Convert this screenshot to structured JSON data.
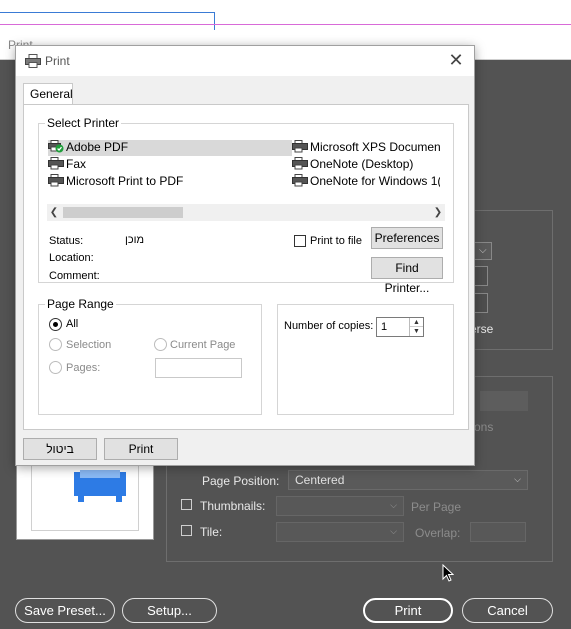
{
  "background": {
    "window_title": "Print",
    "reverse_pages_fragment": "erse",
    "pages_options_fragment": "tions",
    "page_position_label": "Page Position:",
    "page_position_value": "Centered",
    "thumbnails_label": "Thumbnails:",
    "per_page_label": "Per Page",
    "tile_label": "Tile:",
    "overlap_label": "Overlap:",
    "buttons": {
      "save_preset": "Save Preset...",
      "setup": "Setup...",
      "print": "Print",
      "cancel": "Cancel"
    }
  },
  "dialog": {
    "title": "Print",
    "close_glyph": "✕",
    "tab_general": "General",
    "select_printer_label": "Select Printer",
    "printers": [
      {
        "name": "Adobe PDF",
        "selected": true,
        "default": true
      },
      {
        "name": "Fax",
        "selected": false
      },
      {
        "name": "Microsoft Print to PDF",
        "selected": false
      },
      {
        "name": "Microsoft XPS Documen",
        "selected": false
      },
      {
        "name": "OneNote (Desktop)",
        "selected": false
      },
      {
        "name": "OneNote for Windows 1(",
        "selected": false
      }
    ],
    "status_label": "Status:",
    "status_value": "מוכן",
    "location_label": "Location:",
    "comment_label": "Comment:",
    "print_to_file_label": "Print to file",
    "preferences_button": "Preferences",
    "find_printer_button": "Find Printer...",
    "page_range_label": "Page Range",
    "range_all": "All",
    "range_selection": "Selection",
    "range_current_page": "Current Page",
    "range_pages": "Pages:",
    "copies_label": "Number of copies:",
    "copies_value": "1",
    "cancel_button": "ביטול",
    "print_button": "Print"
  },
  "colors": {
    "app_background": "#535353",
    "selection_highlight": "#d9d9d9",
    "accent_blue": "#2d7be5"
  }
}
